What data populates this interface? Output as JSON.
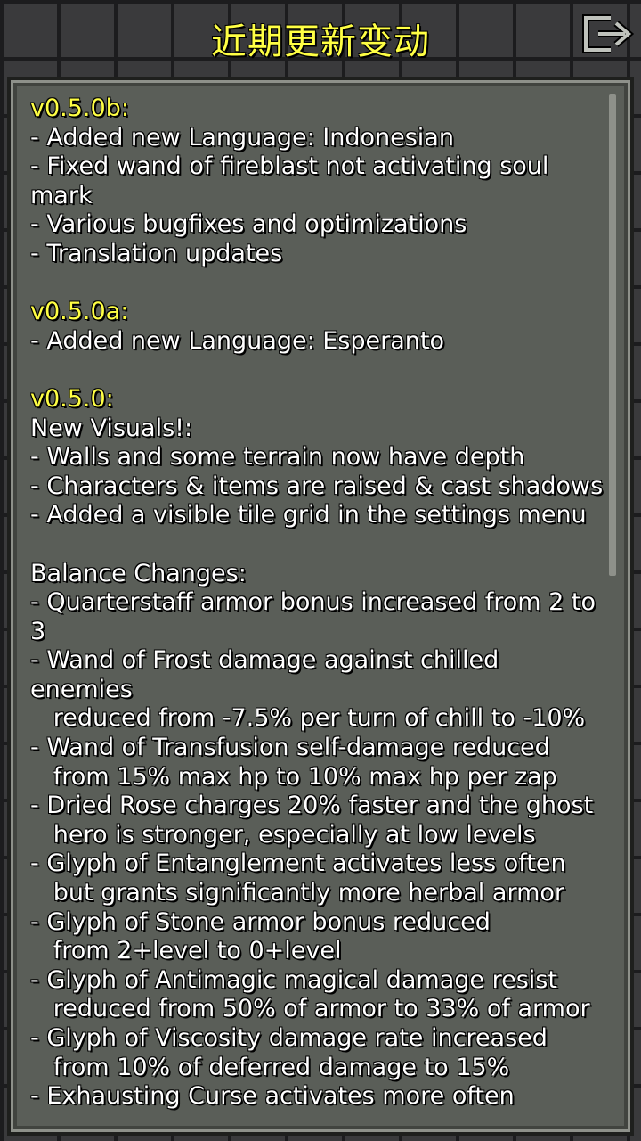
{
  "header": {
    "title": "近期更新变动",
    "exit_icon": "exit-door-arrow-icon"
  },
  "colors": {
    "version_heading": "#ffff44",
    "body_text": "#ffffff",
    "panel_bg": "#5a5e58"
  },
  "changelog": {
    "lines": [
      {
        "text": "v0.5.0b:",
        "kind": "version"
      },
      {
        "text": "- Added new Language: Indonesian",
        "kind": "item"
      },
      {
        "text": "- Fixed wand of fireblast not activating soul",
        "kind": "item"
      },
      {
        "text": "mark",
        "kind": "item"
      },
      {
        "text": "- Various bugfixes and optimizations",
        "kind": "item"
      },
      {
        "text": "- Translation updates",
        "kind": "item"
      },
      {
        "text": "",
        "kind": "blank"
      },
      {
        "text": "v0.5.0a:",
        "kind": "version"
      },
      {
        "text": "- Added new Language: Esperanto",
        "kind": "item"
      },
      {
        "text": "",
        "kind": "blank"
      },
      {
        "text": "v0.5.0:",
        "kind": "version"
      },
      {
        "text": "New Visuals!:",
        "kind": "item"
      },
      {
        "text": "- Walls and some terrain now have depth",
        "kind": "item"
      },
      {
        "text": "- Characters & items are raised & cast shadows",
        "kind": "item"
      },
      {
        "text": "- Added a visible tile grid in the settings menu",
        "kind": "item"
      },
      {
        "text": "",
        "kind": "blank"
      },
      {
        "text": "Balance Changes:",
        "kind": "item"
      },
      {
        "text": "- Quarterstaff armor bonus increased from 2 to",
        "kind": "item"
      },
      {
        "text": "3",
        "kind": "item"
      },
      {
        "text": "- Wand of Frost damage against chilled",
        "kind": "item"
      },
      {
        "text": "enemies",
        "kind": "item"
      },
      {
        "text": "   reduced from -7.5% per turn of chill to -10%",
        "kind": "item"
      },
      {
        "text": "- Wand of Transfusion self-damage reduced",
        "kind": "item"
      },
      {
        "text": "   from 15% max hp to 10% max hp per zap",
        "kind": "item"
      },
      {
        "text": "- Dried Rose charges 20% faster and the ghost",
        "kind": "item"
      },
      {
        "text": "   hero is stronger, especially at low levels",
        "kind": "item"
      },
      {
        "text": "- Glyph of Entanglement activates less often",
        "kind": "item"
      },
      {
        "text": "   but grants significantly more herbal armor",
        "kind": "item"
      },
      {
        "text": "- Glyph of Stone armor bonus reduced",
        "kind": "item"
      },
      {
        "text": "   from 2+level to 0+level",
        "kind": "item"
      },
      {
        "text": "- Glyph of Antimagic magical damage resist",
        "kind": "item"
      },
      {
        "text": "   reduced from 50% of armor to 33% of armor",
        "kind": "item"
      },
      {
        "text": "- Glyph of Viscosity damage rate increased",
        "kind": "item"
      },
      {
        "text": "   from 10% of deferred damage to 15%",
        "kind": "item"
      },
      {
        "text": "- Exhausting Curse activates more often",
        "kind": "item"
      }
    ]
  }
}
